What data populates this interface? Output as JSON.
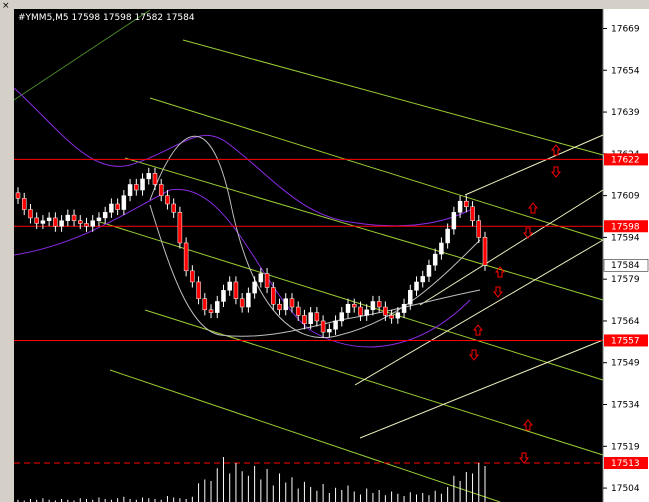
{
  "window": {
    "title": "#YMM5,M5  17598 17598 17582 17584",
    "close_label": "×"
  },
  "chart_data": {
    "type": "candlestick",
    "symbol": "#YMM5",
    "timeframe": "M5",
    "ohlc_header": {
      "open": 17598,
      "high": 17598,
      "low": 17582,
      "close": 17584
    },
    "ylim": [
      17499,
      17676
    ],
    "y_ticks": [
      17669,
      17654,
      17639,
      17624,
      17609,
      17594,
      17579,
      17564,
      17549,
      17534,
      17519,
      17504
    ],
    "current_price": 17584,
    "levels": [
      {
        "label": "17622",
        "value": 17622,
        "style": "solid",
        "color": "#ff0000"
      },
      {
        "label": "17598",
        "value": 17598,
        "style": "solid",
        "color": "#ff0000"
      },
      {
        "label": "17557",
        "value": 17557,
        "style": "solid",
        "color": "#ff0000"
      },
      {
        "label": "17513",
        "value": 17513,
        "style": "dashed",
        "color": "#ff0000"
      }
    ],
    "closes": [
      17608,
      17604,
      17601,
      17599,
      17600,
      17601,
      17598,
      17600,
      17602,
      17600,
      17599,
      17598,
      17600,
      17601,
      17603,
      17606,
      17604,
      17609,
      17613,
      17611,
      17615,
      17617,
      17613,
      17609,
      17606,
      17603,
      17592,
      17582,
      17578,
      17572,
      17568,
      17567,
      17571,
      17575,
      17578,
      17572,
      17569,
      17574,
      17578,
      17581,
      17576,
      17570,
      17568,
      17572,
      17569,
      17566,
      17563,
      17567,
      17564,
      17560,
      17561,
      17564,
      17567,
      17570,
      17569,
      17566,
      17568,
      17571,
      17569,
      17566,
      17565,
      17567,
      17570,
      17575,
      17578,
      17580,
      17584,
      17588,
      17592,
      17597,
      17603,
      17607,
      17605,
      17600,
      17594,
      17584
    ],
    "volume_max": 60,
    "volumes": [
      3,
      2,
      4,
      3,
      5,
      3,
      2,
      4,
      3,
      2,
      5,
      4,
      3,
      6,
      4,
      3,
      5,
      7,
      4,
      3,
      6,
      5,
      4,
      3,
      8,
      6,
      5,
      4,
      7,
      25,
      30,
      28,
      45,
      60,
      38,
      52,
      41,
      35,
      48,
      30,
      44,
      22,
      38,
      26,
      33,
      18,
      27,
      20,
      15,
      24,
      12,
      19,
      16,
      22,
      14,
      10,
      18,
      12,
      16,
      9,
      14,
      11,
      8,
      13,
      10,
      12,
      9,
      15,
      11,
      20,
      35,
      28,
      40,
      38,
      52,
      48
    ]
  }
}
